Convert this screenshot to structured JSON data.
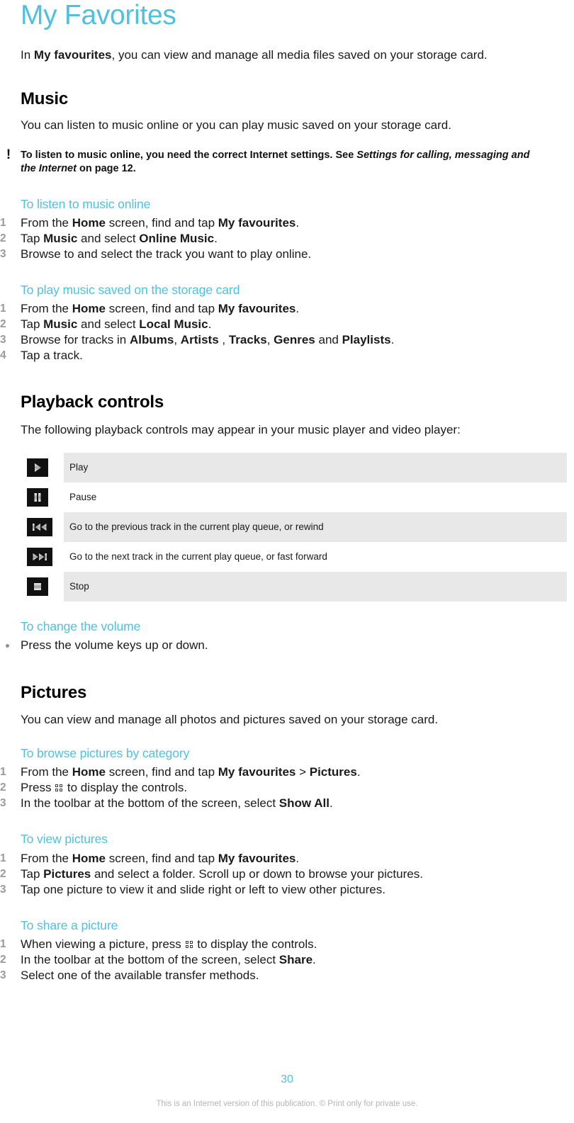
{
  "document": {
    "title": "My Favorites",
    "page_number": "30",
    "footer": "This is an Internet version of this publication. © Print only for private use."
  },
  "intro": {
    "prefix": "In ",
    "bold": "My favourites",
    "suffix": ", you can view and manage all media files saved on your storage card."
  },
  "music": {
    "heading": "Music",
    "description": "You can listen to music online or you can play music saved on your storage card.",
    "note": {
      "icon": "exclamation-icon",
      "part1": "To listen to music online, you need the correct Internet settings. See ",
      "italic": "Settings for calling, messaging and the Internet",
      "part2": " on page 12."
    },
    "task_online": {
      "heading": "To listen to music online",
      "steps": [
        {
          "pre": "From the ",
          "b1": "Home",
          "mid": " screen, find and tap ",
          "b2": "My favourites",
          "post": "."
        },
        {
          "pre": "Tap ",
          "b1": "Music",
          "mid": " and select ",
          "b2": "Online Music",
          "post": "."
        },
        {
          "pre": "Browse to and select the track you want to play online.",
          "b1": "",
          "mid": "",
          "b2": "",
          "post": ""
        }
      ]
    },
    "task_local": {
      "heading": "To play music saved on the storage card",
      "steps": [
        {
          "pre": "From the ",
          "b1": "Home",
          "mid": " screen, find and tap ",
          "b2": "My favourites",
          "post": "."
        },
        {
          "pre": "Tap ",
          "b1": "Music",
          "mid": " and select ",
          "b2": "Local Music",
          "post": "."
        },
        {
          "pre": "Browse for tracks in ",
          "b1": "Albums",
          "mid": ", ",
          "b2": "Artists",
          "post": " , ",
          "b3": "Tracks",
          "post2": ", ",
          "b4": "Genres",
          "post3": " and ",
          "b5": "Playlists",
          "post4": "."
        },
        {
          "pre": "Tap a track.",
          "b1": "",
          "mid": "",
          "b2": "",
          "post": ""
        }
      ]
    }
  },
  "playback": {
    "heading": "Playback controls",
    "description": "The following playback controls may appear in your music player and video player:",
    "rows": [
      {
        "icon": "play-icon",
        "label": "Play",
        "shaded": true
      },
      {
        "icon": "pause-icon",
        "label": "Pause",
        "shaded": false
      },
      {
        "icon": "previous-track-icon",
        "label": "Go to the previous track in the current play queue, or rewind",
        "shaded": true
      },
      {
        "icon": "next-track-icon",
        "label": "Go to the next track in the current play queue, or fast forward",
        "shaded": false
      },
      {
        "icon": "stop-icon",
        "label": "Stop",
        "shaded": true
      }
    ]
  },
  "volume": {
    "heading": "To change the volume",
    "bullet": "Press the volume keys up or down."
  },
  "pictures": {
    "heading": "Pictures",
    "description": "You can view and manage all photos and pictures saved on your storage card.",
    "task_browse": {
      "heading": "To browse pictures by category",
      "step1": {
        "pre": "From the ",
        "b1": "Home",
        "mid": " screen, find and tap ",
        "b2": "My favourites",
        "mid2": " > ",
        "b3": "Pictures",
        "post": "."
      },
      "step2": {
        "pre": "Press ",
        "icon": "menu-key-icon",
        "post": " to display the controls."
      },
      "step3": {
        "pre": "In the toolbar at the bottom of the screen, select ",
        "b1": "Show All",
        "post": "."
      }
    },
    "task_view": {
      "heading": "To view pictures",
      "step1": {
        "pre": "From the ",
        "b1": "Home",
        "mid": " screen, find and tap ",
        "b2": "My favourites",
        "post": "."
      },
      "step2": {
        "pre": "Tap ",
        "b1": "Pictures",
        "post": " and select a folder. Scroll up or down to browse your pictures."
      },
      "step3": {
        "pre": "Tap one picture to view it and slide right or left to view other pictures."
      }
    },
    "task_share": {
      "heading": "To share a picture",
      "step1": {
        "pre": "When viewing a picture, press ",
        "icon": "menu-key-icon",
        "post": " to display the controls."
      },
      "step2": {
        "pre": "In the toolbar at the bottom of the screen, select ",
        "b1": "Share",
        "post": "."
      },
      "step3": {
        "pre": "Select one of the available transfer methods."
      }
    }
  },
  "colors": {
    "accent": "#4fc0df",
    "row_shade": "#e8e8e8",
    "step_number": "#9a9a9a",
    "footer_text": "#b4b4b4"
  }
}
